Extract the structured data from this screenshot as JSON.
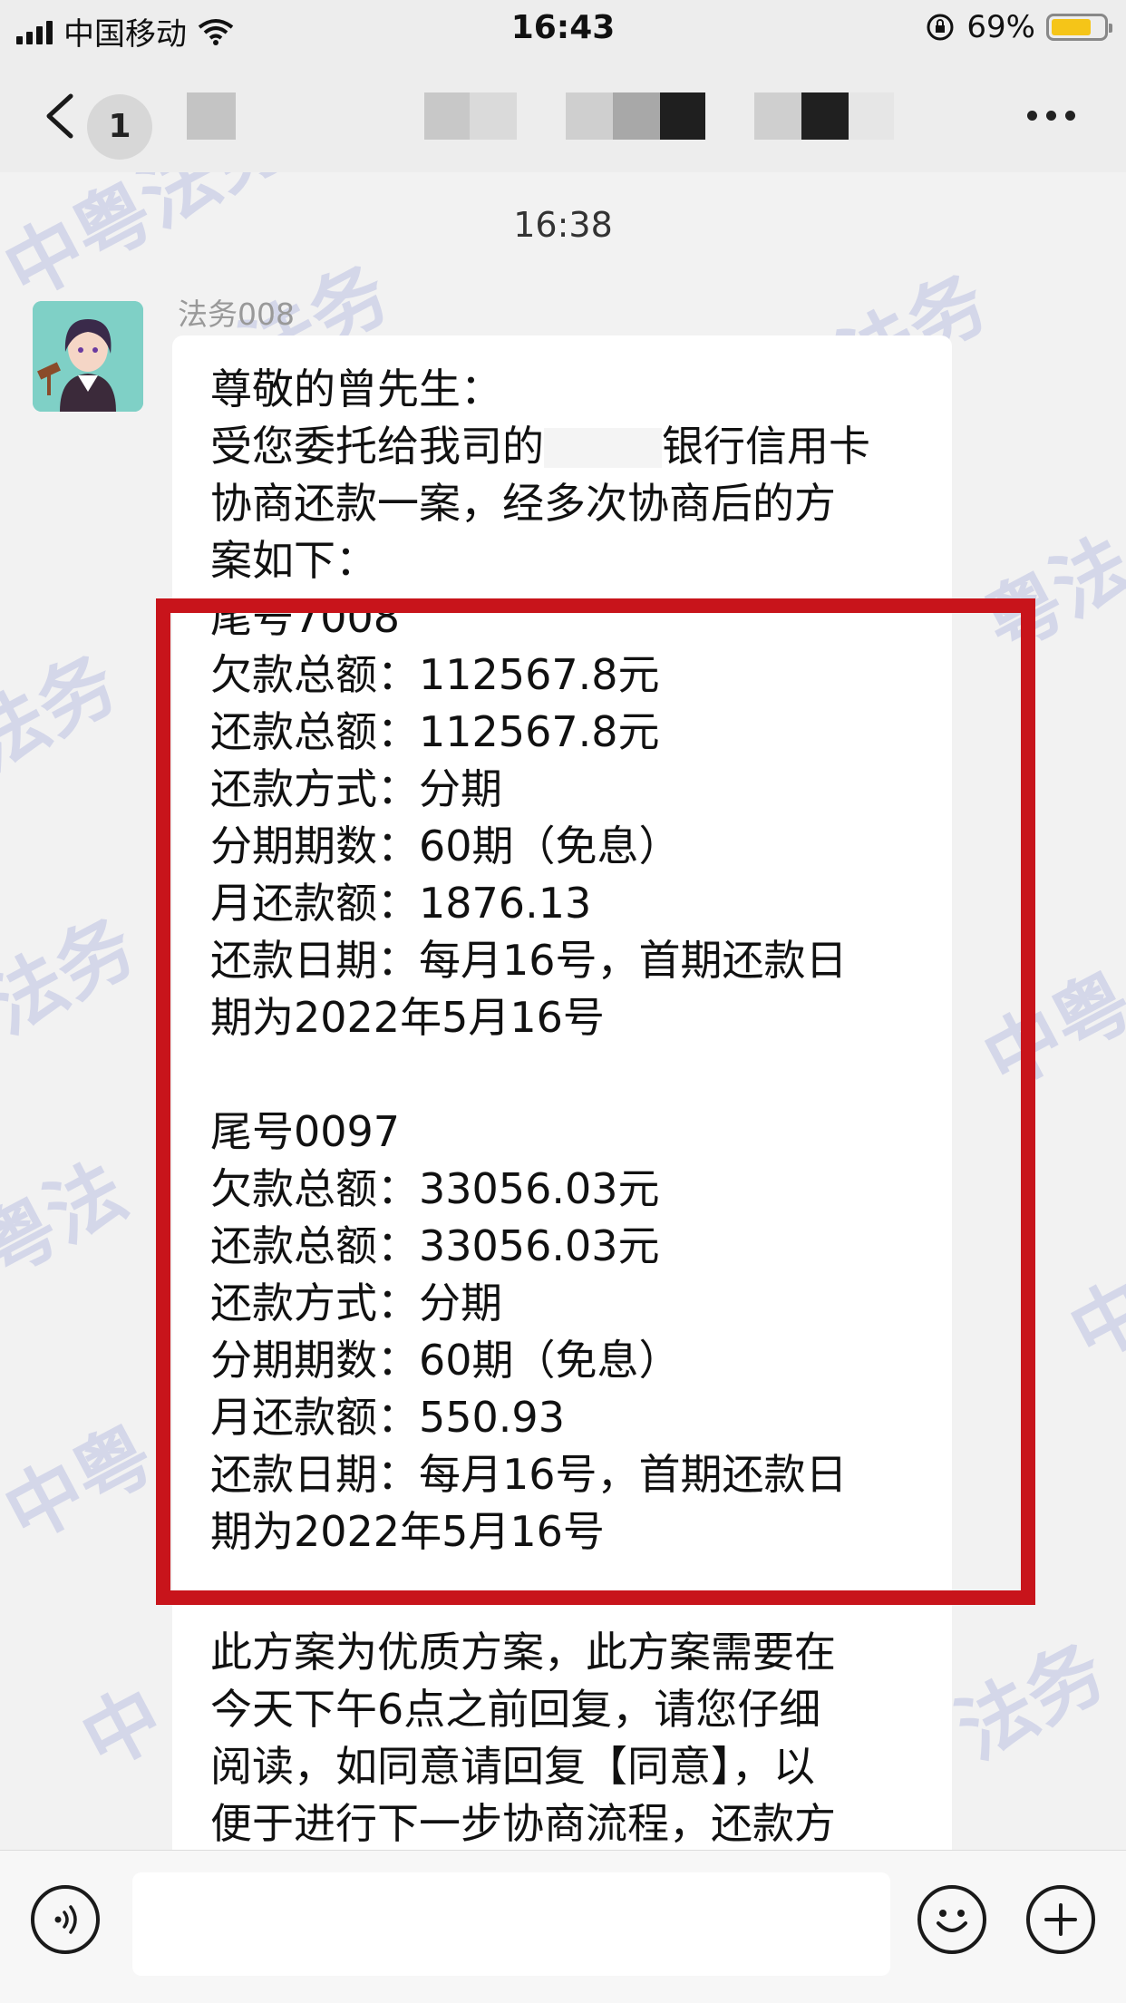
{
  "status_bar": {
    "carrier": "中国移动",
    "time": "16:43",
    "battery_percent": "69%",
    "battery_level": 0.69
  },
  "nav": {
    "unread_count": "1",
    "more_icon": "more-dots-icon",
    "back_icon": "back-chevron-icon"
  },
  "chat": {
    "timestamp": "16:38",
    "sender_name": "法务008",
    "watermark_text": [
      "法务",
      "中粤法务",
      "法务",
      "粤法",
      "中粤",
      "法务",
      "粤法",
      "中",
      "中粤",
      "法务",
      "中",
      "法务"
    ],
    "message_lines": [
      "尊敬的曾先生：",
      "受您委托给我司的",
      "银行信用卡",
      "协商还款一案，经多次协商后的方",
      "案如下：",
      "尾号7008",
      "欠款总额：112567.8元",
      "还款总额：112567.8元",
      "还款方式：分期",
      "分期期数：60期（免息）",
      "月还款额：1876.13",
      "还款日期：每月16号，首期还款日",
      "期为2022年5月16号",
      "尾号0097",
      "欠款总额：33056.03元",
      "还款总额：33056.03元",
      "还款方式：分期",
      "分期期数：60期（免息）",
      "月还款额：550.93",
      "还款日期：每月16号，首期还款日",
      "期为2022年5月16号",
      "此方案为优质方案，此方案需要在",
      "今天下午6点之前回复，请您仔细",
      "阅读，如同意请回复【同意】，以",
      "便于进行下一步协商流程，还款方"
    ],
    "highlight_color": "#c8141b"
  },
  "input_bar": {
    "voice_icon": "voice-icon",
    "emoji_icon": "emoji-icon",
    "add_icon": "plus-icon",
    "input_value": ""
  }
}
